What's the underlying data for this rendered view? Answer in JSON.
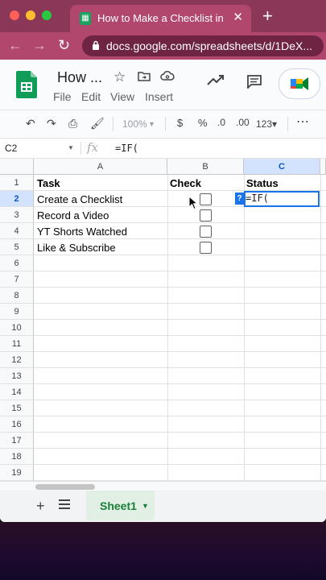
{
  "browser": {
    "tab_title": "How to Make a Checklist in Goo",
    "url": "docs.google.com/spreadsheets/d/1DeX..."
  },
  "sheets": {
    "doc_title": "How ...",
    "menu": [
      "File",
      "Edit",
      "View",
      "Insert"
    ]
  },
  "toolbar": {
    "zoom": "100%",
    "currency": "$",
    "percent": "%",
    "dec_decrease": ".0",
    "dec_increase": ".00",
    "format": "123"
  },
  "formula_bar": {
    "cell_ref": "C2",
    "fx": "fx",
    "formula": "=IF("
  },
  "grid": {
    "columns": [
      "A",
      "B",
      "C"
    ],
    "rows": [
      "1",
      "2",
      "3",
      "4",
      "5",
      "6",
      "7",
      "8",
      "9",
      "10",
      "11",
      "12",
      "13",
      "14",
      "15",
      "16",
      "17",
      "18",
      "19"
    ],
    "headers": {
      "a": "Task",
      "b": "Check",
      "c": "Status"
    },
    "tasks": [
      "Create a Checklist",
      "Record a Video",
      "YT Shorts Watched",
      "Like & Subscribe"
    ],
    "active_edit": "=IF(",
    "hint_badge": "?"
  },
  "footer": {
    "sheet_name": "Sheet1",
    "add_sheet": "+"
  },
  "colors": {
    "browser_frame": "#8a3758",
    "sheets_green": "#188038",
    "selection_blue": "#1a73e8"
  }
}
